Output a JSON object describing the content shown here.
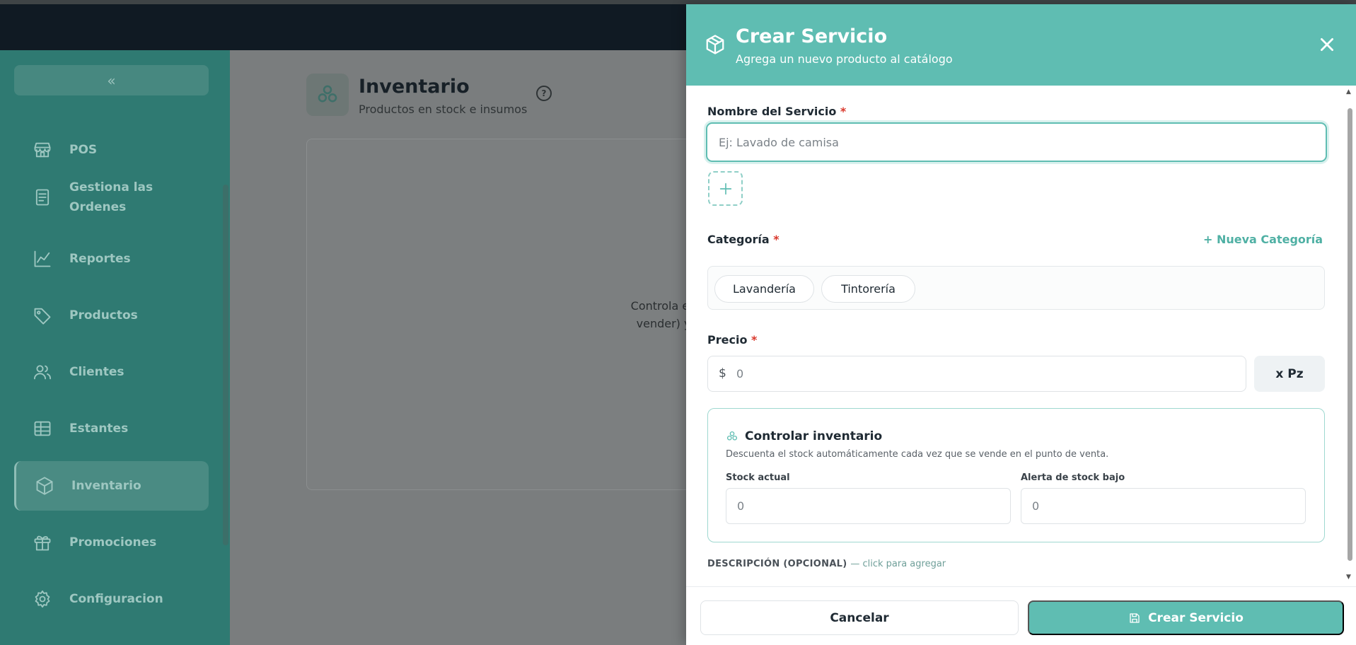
{
  "colors": {
    "accent": "#5fbdb2",
    "sidebar": "#2f7a72",
    "required": "#d9372b"
  },
  "sidebar": {
    "collapse_glyph": "«",
    "items": [
      {
        "label": "POS",
        "icon": "store-icon"
      },
      {
        "label": "Gestiona las Ordenes",
        "icon": "receipt-icon"
      },
      {
        "label": "Reportes",
        "icon": "chart-line-icon"
      },
      {
        "label": "Productos",
        "icon": "tag-icon"
      },
      {
        "label": "Clientes",
        "icon": "users-icon"
      },
      {
        "label": "Estantes",
        "icon": "table-icon"
      },
      {
        "label": "Inventario",
        "icon": "box-icon",
        "active": true
      },
      {
        "label": "Promociones",
        "icon": "gift-icon"
      },
      {
        "label": "Configuracion",
        "icon": "gear-icon"
      }
    ]
  },
  "page": {
    "title": "Inventario",
    "subtitle": "Productos en stock e insumos",
    "help": "?",
    "card_text": "Controla el st\nvender) y c"
  },
  "drawer": {
    "title": "Crear Servicio",
    "subtitle": "Agrega un nuevo producto al catálogo",
    "name_label": "Nombre del Servicio",
    "required_mark": "*",
    "name_placeholder": "Ej: Lavado de camisa",
    "category_label": "Categoría",
    "new_category": "Nueva Categoría",
    "categories": [
      "Lavandería",
      "Tintorería"
    ],
    "price_label": "Precio",
    "currency_symbol": "$",
    "price_value": "0",
    "unit": "x Pz",
    "inventory": {
      "title": "Controlar inventario",
      "description": "Descuenta el stock automáticamente cada vez que se vende en el punto de venta.",
      "stock_label": "Stock actual",
      "stock_value": "0",
      "alert_label": "Alerta de stock bajo",
      "alert_value": "0"
    },
    "description_label": "DESCRIPCIÓN (OPCIONAL)",
    "description_hint": "— click para agregar",
    "cancel": "Cancelar",
    "create": "Crear Servicio"
  }
}
